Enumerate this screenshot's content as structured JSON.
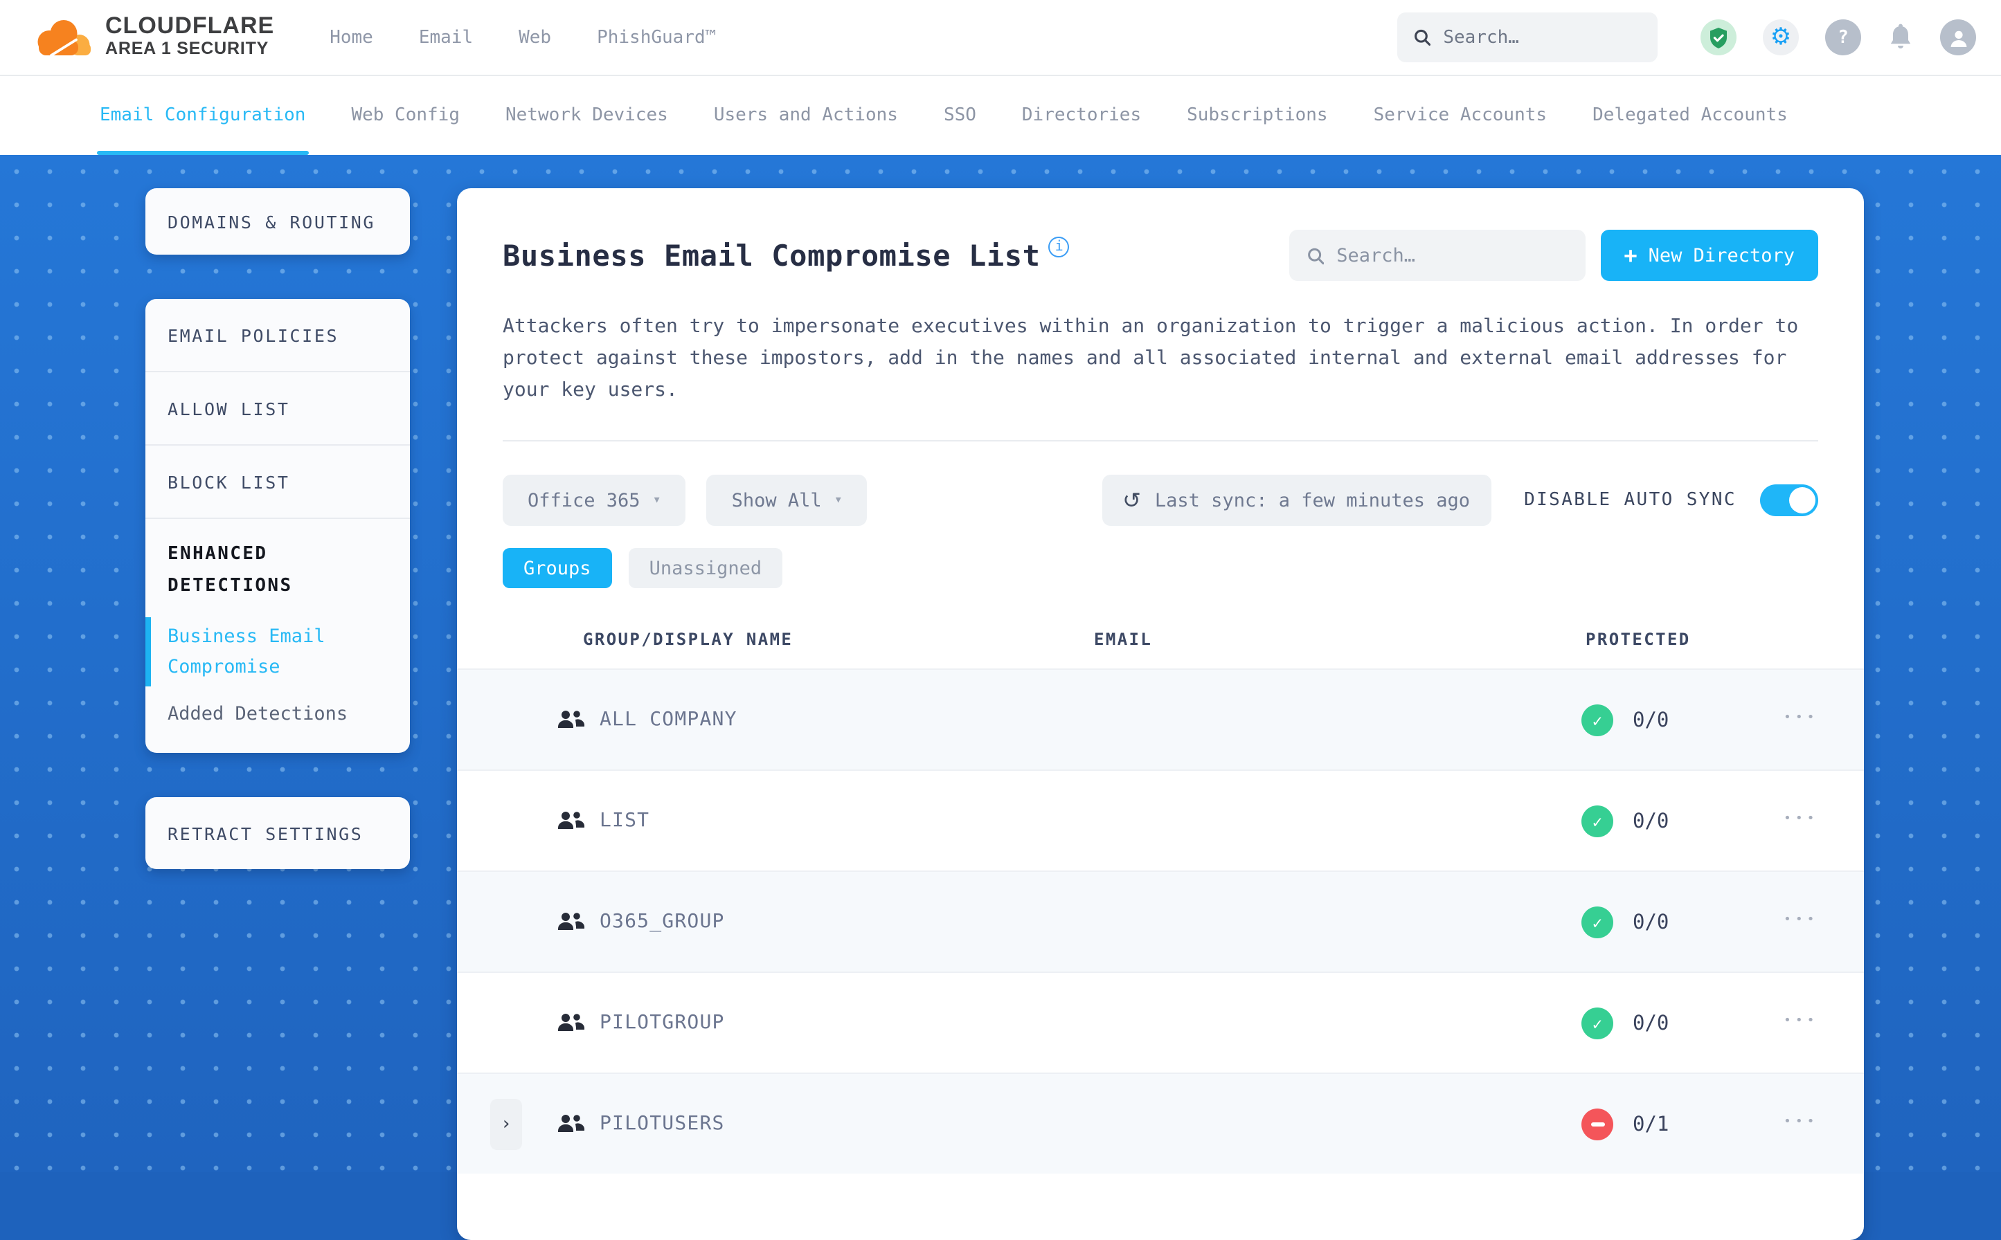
{
  "brand": {
    "name": "CLOUDFLARE",
    "product": "AREA 1 SECURITY"
  },
  "topnav": {
    "search_placeholder": "Search…",
    "items": [
      {
        "label": "Home"
      },
      {
        "label": "Email"
      },
      {
        "label": "Web"
      },
      {
        "label": "PhishGuard™"
      }
    ]
  },
  "tabs": [
    {
      "label": "Email Configuration",
      "active": true
    },
    {
      "label": "Web Config"
    },
    {
      "label": "Network Devices"
    },
    {
      "label": "Users and Actions"
    },
    {
      "label": "SSO"
    },
    {
      "label": "Directories"
    },
    {
      "label": "Subscriptions"
    },
    {
      "label": "Service Accounts"
    },
    {
      "label": "Delegated Accounts"
    }
  ],
  "sidebar": {
    "domains_routing": "DOMAINS & ROUTING",
    "email_policies": "EMAIL POLICIES",
    "allow_list": "ALLOW LIST",
    "block_list": "BLOCK LIST",
    "enhanced_detections": "ENHANCED DETECTIONS",
    "business_email_compromise": "Business Email Compromise",
    "added_detections": "Added Detections",
    "retract_settings": "RETRACT SETTINGS"
  },
  "main": {
    "title": "Business Email Compromise List",
    "search_placeholder": "Search…",
    "new_directory_label": "New Directory",
    "description": "Attackers often try to impersonate executives within an organization to trigger a malicious action. In order to protect against these impostors, add in the names and all associated internal and external email addresses for your key users.",
    "filters": {
      "directory_select": "Office 365",
      "show_select": "Show All",
      "last_sync": "Last sync: a few minutes ago",
      "auto_sync_label": "DISABLE AUTO SYNC",
      "auto_sync_on": true
    },
    "view_tabs": {
      "groups": "Groups",
      "unassigned": "Unassigned"
    },
    "table": {
      "headers": {
        "name": "GROUP/DISPLAY NAME",
        "email": "EMAIL",
        "protected": "PROTECTED"
      },
      "rows": [
        {
          "name": "ALL COMPANY",
          "email": "",
          "protected": "0/0",
          "status": "ok",
          "expandable": false
        },
        {
          "name": "LIST",
          "email": "",
          "protected": "0/0",
          "status": "ok",
          "expandable": false
        },
        {
          "name": "O365_GROUP",
          "email": "",
          "protected": "0/0",
          "status": "ok",
          "expandable": false
        },
        {
          "name": "PILOTGROUP",
          "email": "",
          "protected": "0/0",
          "status": "ok",
          "expandable": false
        },
        {
          "name": "PILOTUSERS",
          "email": "",
          "protected": "0/1",
          "status": "blocked",
          "expandable": true
        }
      ]
    }
  },
  "icons": {
    "plus": "+",
    "caret_down": "▾",
    "chevron_right": "›",
    "ellipsis": "•••",
    "refresh": "↺",
    "check": "✓",
    "question": "?",
    "info": "i"
  },
  "colors": {
    "accent": "#18b3f7",
    "active_tab": "#28b9f5",
    "ok_green": "#36cf93",
    "blocked_red": "#f4555a",
    "bg_blue_top": "#2577d7",
    "bg_blue_bottom": "#1f64bf"
  }
}
